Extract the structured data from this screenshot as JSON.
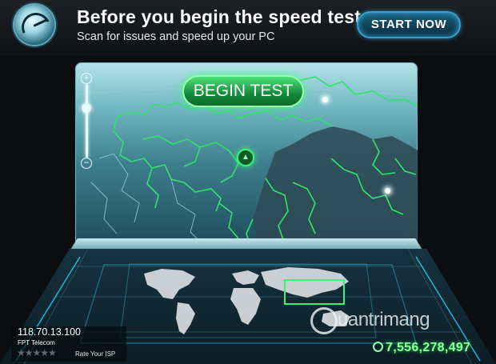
{
  "banner": {
    "title": "Before you begin the speed test:",
    "subtitle": "Scan for issues and speed up your PC",
    "cta_label": "START NOW"
  },
  "map_panel": {
    "begin_label": "BEGIN TEST",
    "zoom_plus": "+",
    "zoom_minus": "−",
    "target_glyph": "▲",
    "zoom_level": 0.7
  },
  "connection": {
    "ip": "118.70.13.100",
    "isp": "FPT Telecom",
    "rating_stars": "★★★★★",
    "rate_label": "Rate Your ISP"
  },
  "counter": {
    "tests_count": "7,556,278,497"
  },
  "watermark": {
    "text": "uantrimang"
  },
  "colors": {
    "accent_green": "#3df27a",
    "accent_blue": "#3aa0c7",
    "map_lines": "#33e26b"
  },
  "icons": {
    "logo": "speedometer-logo",
    "target": "triangle-up-icon",
    "counter": "globe-icon"
  }
}
